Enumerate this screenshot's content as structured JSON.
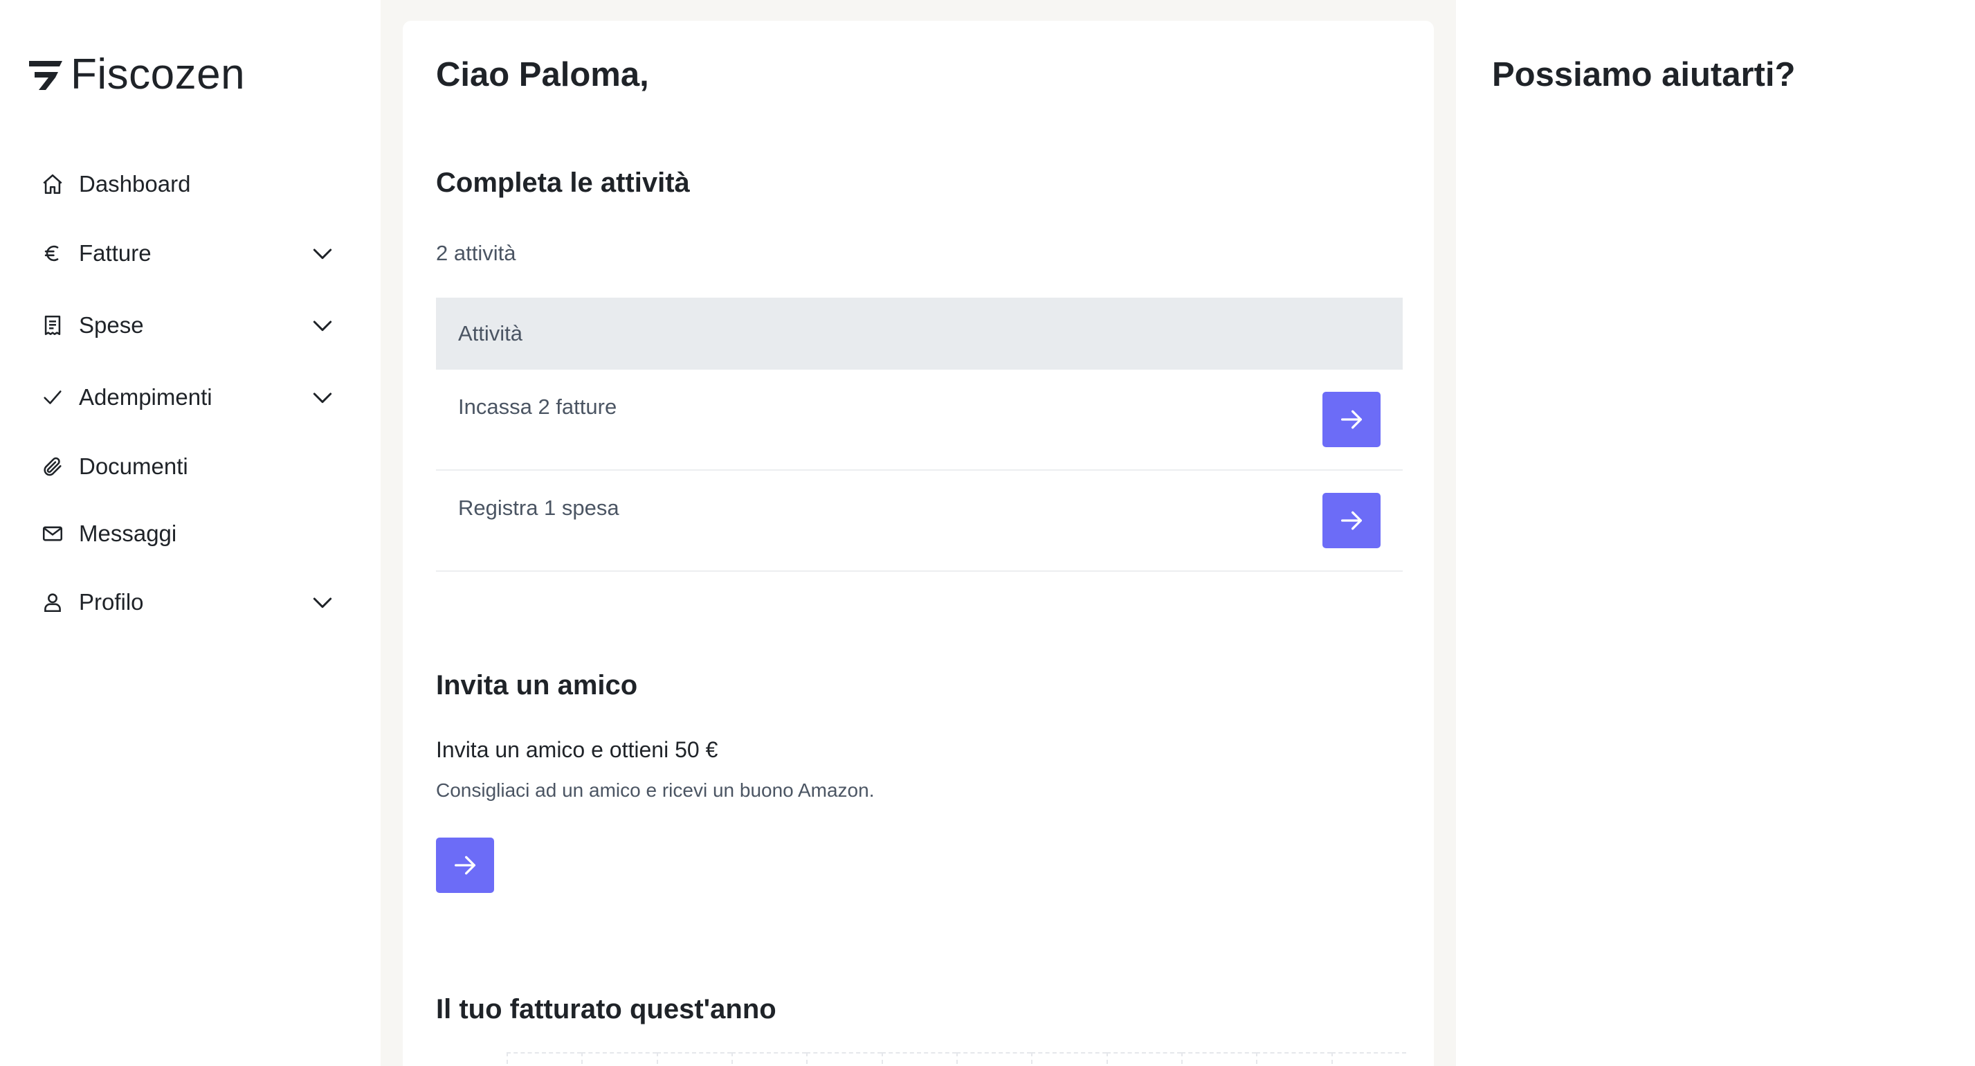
{
  "brand": {
    "name": "Fiscozen"
  },
  "sidebar": {
    "items": [
      {
        "label": "Dashboard",
        "icon": "home-icon",
        "expandable": false
      },
      {
        "label": "Fatture",
        "icon": "euro-icon",
        "expandable": true
      },
      {
        "label": "Spese",
        "icon": "receipt-icon",
        "expandable": true
      },
      {
        "label": "Adempimenti",
        "icon": "check-icon",
        "expandable": true
      },
      {
        "label": "Documenti",
        "icon": "paperclip-icon",
        "expandable": false
      },
      {
        "label": "Messaggi",
        "icon": "mail-icon",
        "expandable": false
      },
      {
        "label": "Profilo",
        "icon": "user-icon",
        "expandable": true
      }
    ]
  },
  "main": {
    "greeting": "Ciao Paloma,",
    "tasks": {
      "title": "Completa le attività",
      "count": "2 attività",
      "column_header": "Attività",
      "rows": [
        {
          "label": "Incassa 2 fatture"
        },
        {
          "label": "Registra 1 spesa"
        }
      ]
    },
    "invite": {
      "title": "Invita un amico",
      "text": "Invita un amico e ottieni 50 €",
      "subtext": "Consigliaci ad un amico e ricevi un buono Amazon."
    },
    "revenue": {
      "title": "Il tuo fatturato quest'anno"
    }
  },
  "help": {
    "title": "Possiamo aiutarti?"
  },
  "colors": {
    "accent": "#6c6cf7",
    "page_background": "#f7f6f3",
    "table_header": "#e8ebee",
    "text": "#1f2328",
    "muted_text": "#4b5563"
  }
}
